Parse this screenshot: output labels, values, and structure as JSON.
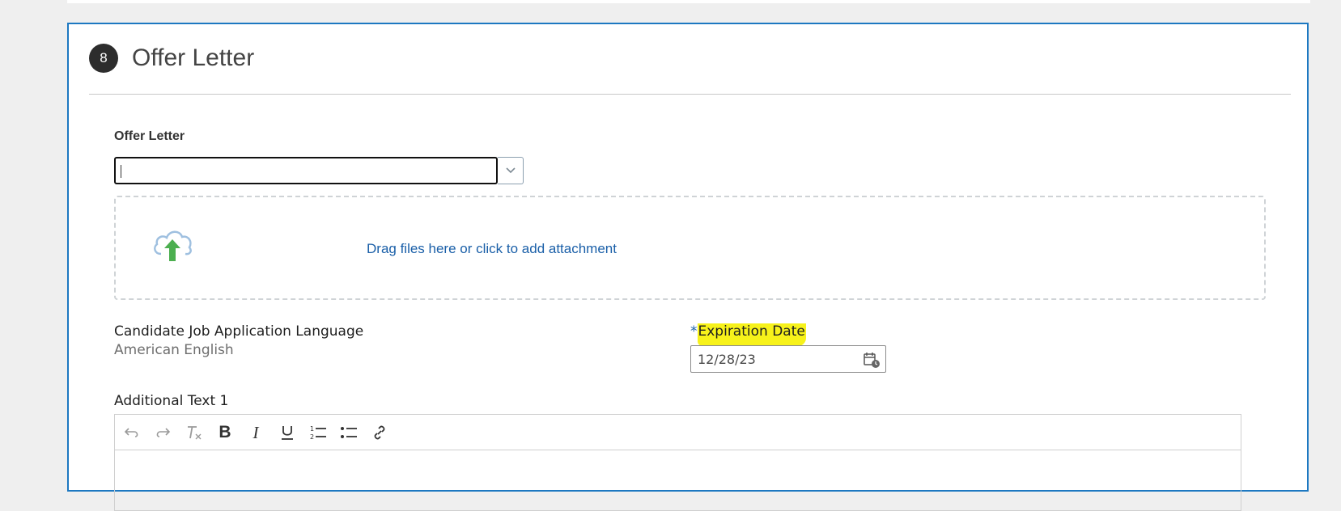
{
  "section": {
    "step_number": "8",
    "title": "Offer Letter"
  },
  "offer_letter": {
    "label": "Offer Letter",
    "value": "",
    "dropdown_icon": "chevron-down-icon"
  },
  "attachment": {
    "icon": "cloud-upload-icon",
    "text": "Drag files here or click to add attachment"
  },
  "language": {
    "label": "Candidate Job Application Language",
    "value": "American English"
  },
  "expiration": {
    "required_marker": "*",
    "label": "Expiration Date",
    "value": "12/28/23",
    "icon": "calendar-icon",
    "highlight_color": "#f7f21a"
  },
  "additional_text": {
    "label": "Additional Text 1",
    "toolbar": [
      "undo-icon",
      "redo-icon",
      "clear-formatting-icon",
      "bold-icon",
      "italic-icon",
      "underline-icon",
      "numbered-list-icon",
      "bulleted-list-icon",
      "link-icon"
    ]
  },
  "colors": {
    "accent": "#1d78c1",
    "link": "#1a5fa8",
    "upload_arrow": "#4caf50"
  }
}
